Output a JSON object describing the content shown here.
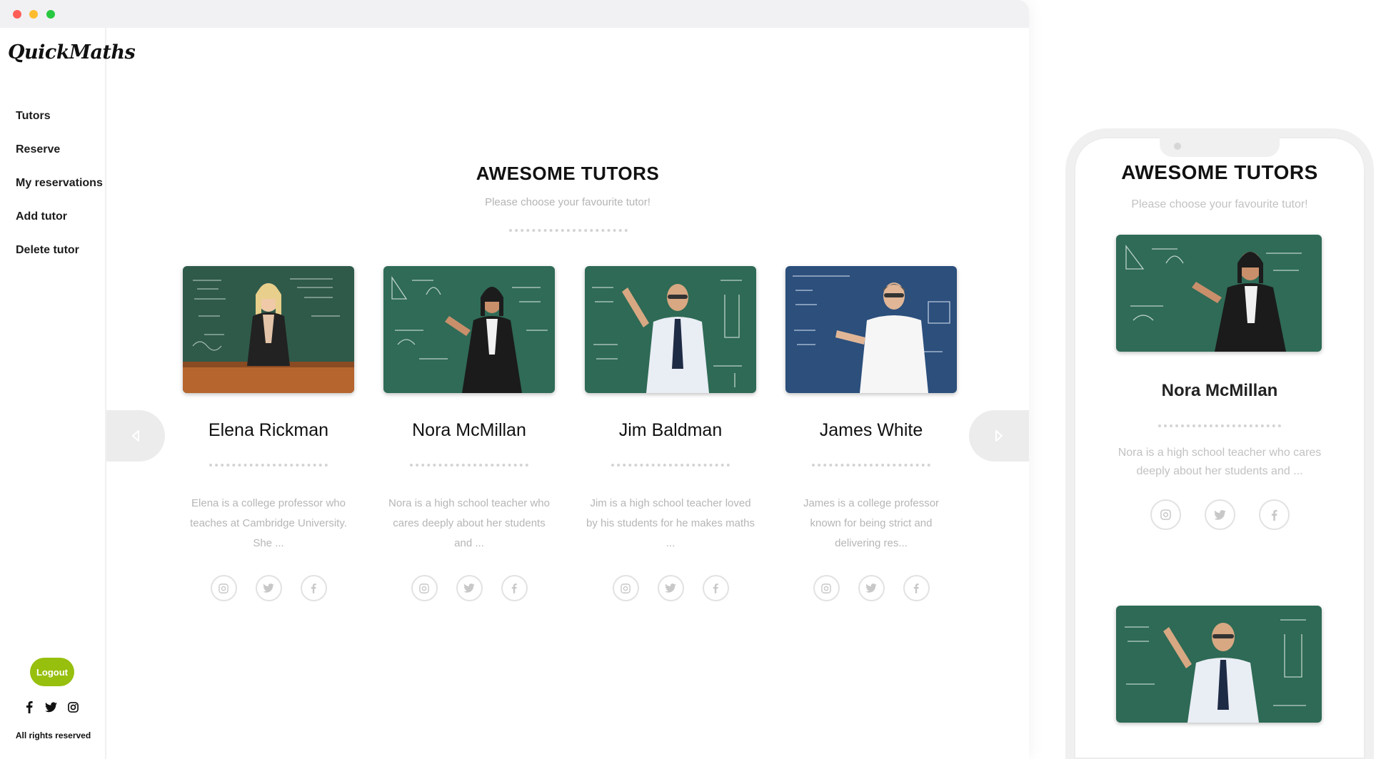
{
  "sidebar": {
    "logo": "QuickMaths",
    "nav": [
      "Tutors",
      "Reserve",
      "My reservations",
      "Add tutor",
      "Delete tutor"
    ],
    "logout_label": "Logout",
    "footer_icons": [
      "facebook-icon",
      "twitter-icon",
      "instagram-icon"
    ],
    "rights": "All rights reserved"
  },
  "main": {
    "title": "AWESOME TUTORS",
    "subtitle": "Please choose your favourite tutor!",
    "tutors": [
      {
        "name": "Elena Rickman",
        "desc": "Elena is a college professor who teaches at Cambridge University. She ..."
      },
      {
        "name": "Nora McMillan",
        "desc": "Nora is a high school teacher who cares deeply about her students and ..."
      },
      {
        "name": "Jim Baldman",
        "desc": "Jim is a high school teacher loved by his students for he makes maths ..."
      },
      {
        "name": "James White",
        "desc": "James is a college professor known for being strict and delivering res..."
      }
    ]
  },
  "mobile": {
    "title": "AWESOME TUTORS",
    "subtitle": "Please choose your favourite tutor!",
    "tutor": {
      "name": "Nora McMillan",
      "desc": "Nora is a high school teacher who cares deeply about her students and ..."
    }
  },
  "colors": {
    "accent": "#97bf0d",
    "board_green": "#2f6b57",
    "board_blue": "#2c4f7c"
  }
}
